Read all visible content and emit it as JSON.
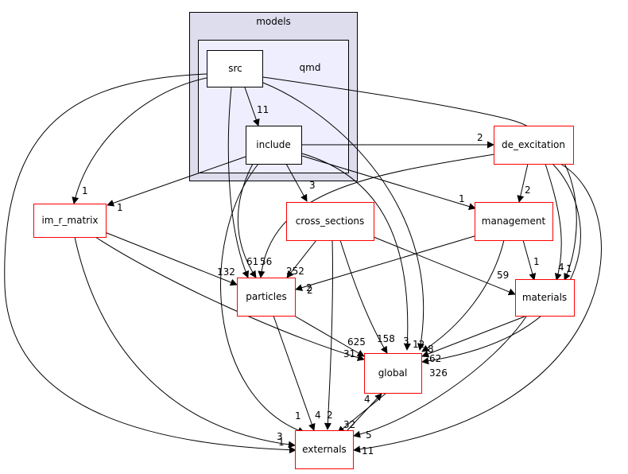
{
  "diagram": {
    "type": "directory-dependency-graph",
    "clusters": [
      {
        "id": "models",
        "label": "models"
      },
      {
        "id": "qmd",
        "label": "qmd"
      }
    ],
    "nodes": [
      {
        "id": "src",
        "label": "src",
        "style": "folder-inner"
      },
      {
        "id": "include",
        "label": "include",
        "style": "folder-inner"
      },
      {
        "id": "de_excitation",
        "label": "de_excitation",
        "style": "external-dir"
      },
      {
        "id": "im_r_matrix",
        "label": "im_r_matrix",
        "style": "external-dir"
      },
      {
        "id": "cross_sections",
        "label": "cross_sections",
        "style": "external-dir"
      },
      {
        "id": "management",
        "label": "management",
        "style": "external-dir"
      },
      {
        "id": "particles",
        "label": "particles",
        "style": "external-dir"
      },
      {
        "id": "materials",
        "label": "materials",
        "style": "external-dir"
      },
      {
        "id": "global",
        "label": "global",
        "style": "external-dir"
      },
      {
        "id": "externals",
        "label": "externals",
        "style": "external-dir"
      }
    ],
    "edges": [
      {
        "from": "src",
        "to": "include",
        "label": "11"
      },
      {
        "from": "src",
        "to": "im_r_matrix",
        "label": "1"
      },
      {
        "from": "src",
        "to": "particles",
        "label": "61"
      },
      {
        "from": "src",
        "to": "materials",
        "label": "1"
      },
      {
        "from": "src",
        "to": "global",
        "label": "12"
      },
      {
        "from": "src",
        "to": "externals",
        "label": "3"
      },
      {
        "from": "include",
        "to": "de_excitation",
        "label": "2"
      },
      {
        "from": "include",
        "to": "im_r_matrix",
        "label": "1"
      },
      {
        "from": "include",
        "to": "cross_sections",
        "label": "3"
      },
      {
        "from": "include",
        "to": "management",
        "label": "1"
      },
      {
        "from": "include",
        "to": "particles",
        "label": "56"
      },
      {
        "from": "include",
        "to": "global",
        "label": "3"
      },
      {
        "from": "include",
        "to": "externals",
        "label": "1"
      },
      {
        "from": "de_excitation",
        "to": "management",
        "label": "2"
      },
      {
        "from": "de_excitation",
        "to": "particles",
        "label": "2"
      },
      {
        "from": "de_excitation",
        "to": "materials",
        "label": "4"
      },
      {
        "from": "de_excitation",
        "to": "global",
        "label": "62"
      },
      {
        "from": "de_excitation",
        "to": "externals",
        "label": "11"
      },
      {
        "from": "im_r_matrix",
        "to": "particles",
        "label": "132"
      },
      {
        "from": "im_r_matrix",
        "to": "global",
        "label": "31"
      },
      {
        "from": "im_r_matrix",
        "to": "externals",
        "label": "1"
      },
      {
        "from": "cross_sections",
        "to": "particles",
        "label": "252"
      },
      {
        "from": "cross_sections",
        "to": "materials",
        "label": "59"
      },
      {
        "from": "cross_sections",
        "to": "global",
        "label": "158"
      },
      {
        "from": "cross_sections",
        "to": "externals",
        "label": "2"
      },
      {
        "from": "management",
        "to": "particles",
        "label": "2"
      },
      {
        "from": "management",
        "to": "materials",
        "label": "1"
      },
      {
        "from": "management",
        "to": "global",
        "label": "8"
      },
      {
        "from": "particles",
        "to": "global",
        "label": "625"
      },
      {
        "from": "particles",
        "to": "externals",
        "label": "4"
      },
      {
        "from": "materials",
        "to": "global",
        "label": "326"
      },
      {
        "from": "materials",
        "to": "externals",
        "label": "5"
      },
      {
        "from": "global",
        "to": "externals",
        "label": "32"
      },
      {
        "from": "externals",
        "to": "global",
        "label": "4"
      }
    ]
  },
  "colors": {
    "cluster_outer_fill": "#ddddee",
    "cluster_inner_fill": "#eeeeff",
    "external_dir_border": "#ff0000",
    "inner_dir_border": "#000000"
  }
}
